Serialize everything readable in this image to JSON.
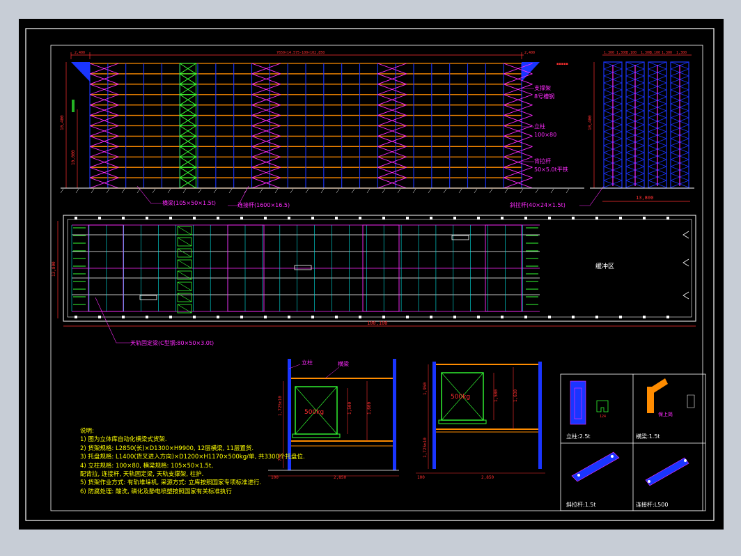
{
  "drawing": {
    "top_dim_left": "2,400",
    "top_dim_main": "7650×14.575-100×102,850",
    "top_dim_right": "2,400",
    "height_total": "10,400",
    "height_lower": "10,000",
    "label_brace": "支撑架",
    "label_brace_2": "8号槽钢",
    "label_column": "立柱",
    "label_column_2": "100×80",
    "label_back_tie": "背拉杆",
    "label_back_tie_2": "50×5.0t平铁",
    "label_beam": "横梁(105×50×1.5t)",
    "label_connector": "连接杆(1600×16.5)",
    "label_diagonal": "斜拉杆(40×24×1.5t)",
    "side_dims": [
      "1,300",
      "1,300",
      "3,100",
      "1,300",
      "3,100",
      "1,300",
      "1,300"
    ],
    "side_height": "10,400",
    "side_width": "13,800",
    "plan_height": "13,800",
    "plan_width": "100,100",
    "buffer_zone": "缓冲区",
    "label_rail": "天轨固定梁(C型钢:80×50×3.0t)",
    "sec1_column": "立柱",
    "sec1_beam": "横梁",
    "load": "500kg",
    "sec1_dims": [
      "1,725±10",
      "1,500",
      "1,600",
      "700"
    ],
    "sec1_bottom": [
      "100",
      "2,850"
    ],
    "sec2_dims": [
      "1,950",
      "1,500",
      "1,630",
      "1,725±10"
    ],
    "sec2_bottom": [
      "100",
      "2,850"
    ],
    "parts": [
      {
        "label": "立柱:2.5t"
      },
      {
        "label": "横梁:1.5t"
      },
      {
        "label": "斜拉杆:1.5t"
      },
      {
        "label": "连接杆:L500"
      }
    ],
    "part_extra_1": "124",
    "part_extra_2": "保上简"
  },
  "notes": {
    "title": "说明:",
    "lines": [
      "1) 图为立体库自动化横梁式货架.",
      "2) 货架规格: L2850(长)×D1300×H9900, 12层横梁, 11层置货.",
      "3) 托盘规格: L1400(货叉进入方向)×D1200×H1170×500kg/单, 共3300个托盘位.",
      "4) 立柱规格: 100×80, 横梁规格: 105×50×1.5t,",
      "   配背拉, 连接杆, 天轨固定梁, 天轨支撑架, 柱护.",
      "5) 货架作业方式: 有轨堆垛机, 采源方式: 立库按照国家专项标准进行.",
      "6) 防腐处理: 酸洗, 磷化及静电喷塑按照国家有关标准执行"
    ]
  },
  "colors": {
    "background": "#000000",
    "orange": "#ff8c00",
    "blue": "#1a35ff",
    "magenta": "#ff2bff",
    "green": "#33ff33",
    "cyan": "#00e5e5",
    "red": "#ff3030",
    "yellow": "#ffff00",
    "white": "#ffffff"
  }
}
